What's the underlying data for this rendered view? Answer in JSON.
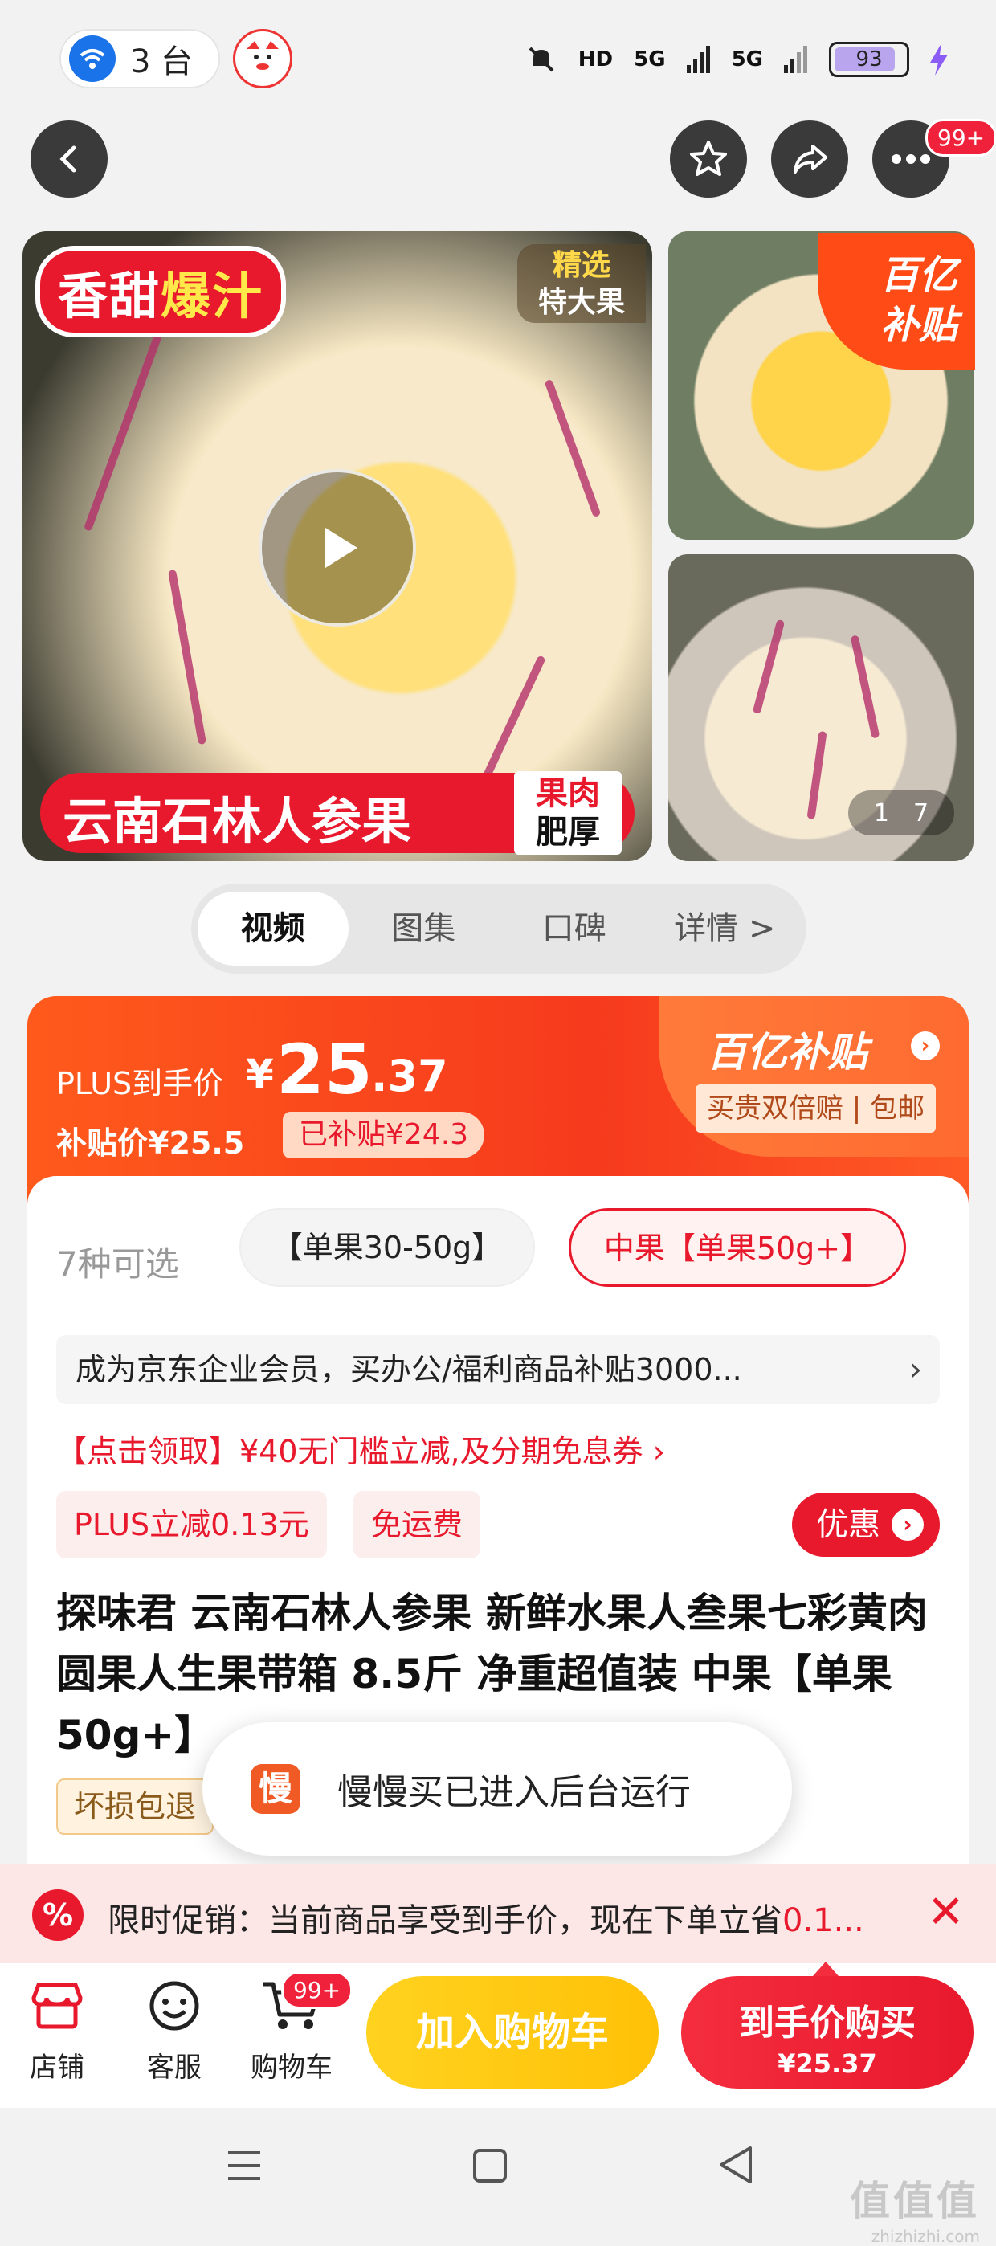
{
  "status_bar": {
    "devices_count": "3 台",
    "battery": "93",
    "network_labels": [
      "HD",
      "5G",
      "5G"
    ]
  },
  "nav": {
    "more_badge": "99+"
  },
  "gallery": {
    "main_tag_prefix": "香甜",
    "main_tag_highlight": "爆汁",
    "select_tag_line1": "精选",
    "select_tag_line2": "特大果",
    "product_band": "云南石林人参果",
    "band_side_line1": "果肉",
    "band_side_line2": "肥厚",
    "subsidy_line1": "百亿",
    "subsidy_line2": "补贴",
    "index_current": "1",
    "index_total": "7"
  },
  "tabs": [
    {
      "label": "视频",
      "active": true
    },
    {
      "label": "图集",
      "active": false
    },
    {
      "label": "口碑",
      "active": false
    },
    {
      "label": "详情 >",
      "active": false
    }
  ],
  "price": {
    "plus_label": "PLUS到手价",
    "currency": "¥",
    "integer": "25",
    "decimal": ".37",
    "subsidy_price": "补贴价¥25.5",
    "subsidy_tag": "已补贴¥24.3",
    "yi_title": "百亿补贴",
    "yi_sub": "买贵双倍赔 | 包邮"
  },
  "options": {
    "count": "7种可选",
    "items": [
      "【单果30-50g】",
      "中果【单果50g+】"
    ],
    "selected_index": 1
  },
  "member_banner": "成为京东企业会员，买办公/福利商品补贴3000...",
  "member_arrow": "›",
  "coupon": "【点击领取】¥40无门槛立减,及分期免息券 ›",
  "chips": [
    "PLUS立减0.13元",
    "免运费"
  ],
  "youhui": "优惠",
  "product_title": "探味君 云南石林人参果 新鲜水果人叁果七彩黄肉圆果人生果带箱 8.5斤 净重超值装 中果【单果50g+】",
  "guarantee": "坏损包退",
  "toast": {
    "icon_char": "慢",
    "text": "慢慢买已进入后台运行"
  },
  "promo": {
    "prefix": "限时促销：当前商品享受到手价，现在下单立省",
    "highlight": "0.1..."
  },
  "bottom_bar": {
    "shop": "店铺",
    "service": "客服",
    "cart": "购物车",
    "cart_badge": "99+",
    "add_to_cart": "加入购物车",
    "buy_label": "到手价购买",
    "buy_price": "¥25.37"
  },
  "watermark": {
    "big": "值值值",
    "small": "zhizhizhi.com"
  }
}
